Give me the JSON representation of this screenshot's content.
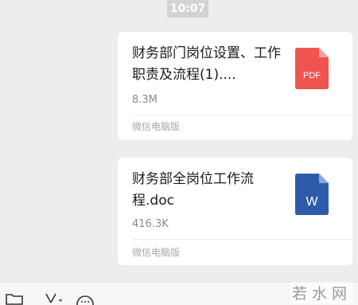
{
  "timestamp": "10:07",
  "messages": [
    {
      "file_name": "财务部门岗位设置、工作职责及流程(1)....",
      "file_size": "8.3M",
      "source": "微信电脑版",
      "file_type": "PDF",
      "icon_color": "#f0544f",
      "icon": "pdf-file-icon"
    },
    {
      "file_name": "财务部全岗位工作流程.doc",
      "file_size": "416.3K",
      "source": "微信电脑版",
      "file_type": "W",
      "icon_color": "#2e5ba8",
      "icon": "word-file-icon"
    }
  ],
  "toolbar": {
    "icons": [
      "folder-icon",
      "scissors-icon",
      "emoji-icon"
    ]
  },
  "watermark": "若水网"
}
